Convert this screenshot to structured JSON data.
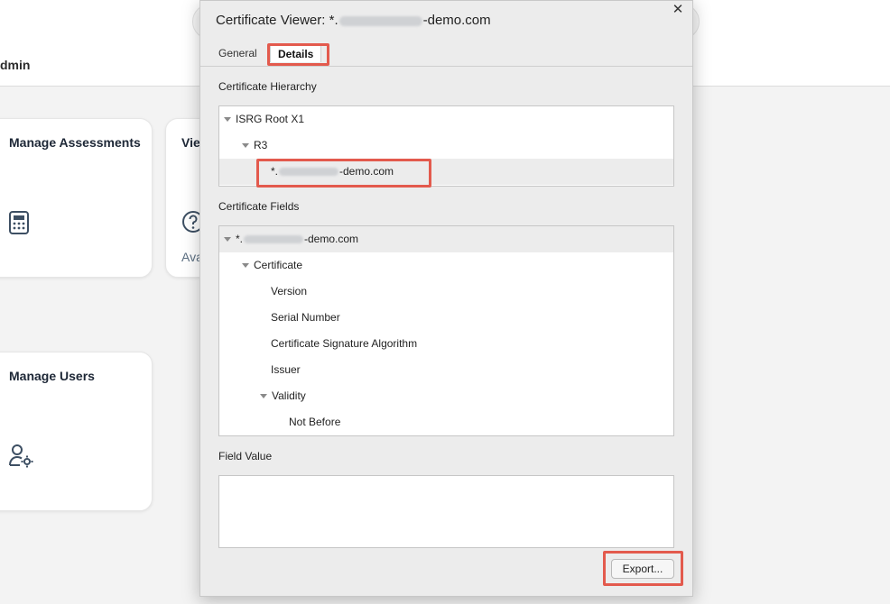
{
  "background": {
    "topbar": {
      "user_label": "dmin"
    },
    "cards": [
      {
        "title": "Manage Assessments",
        "icon": "calculator-icon"
      },
      {
        "title": "Vie",
        "icon": "help-circle-icon",
        "sub": "Ava"
      },
      {
        "title": "Manage Users",
        "icon": "user-settings-icon"
      }
    ]
  },
  "dialog": {
    "title_prefix": "Certificate Viewer: *.",
    "title_suffix": "-demo.com",
    "close_icon": "✕",
    "tabs": [
      {
        "label": "General",
        "active": false
      },
      {
        "label": "Details",
        "active": true
      }
    ],
    "hierarchy_label": "Certificate Hierarchy",
    "hierarchy": [
      {
        "label": "ISRG Root X1",
        "expanded": true
      },
      {
        "label": "R3",
        "expanded": true
      },
      {
        "prefix": "*.",
        "suffix": "-demo.com",
        "selected": true
      }
    ],
    "fields_label": "Certificate Fields",
    "fields": [
      {
        "prefix": "*.",
        "suffix": "-demo.com",
        "expanded": true,
        "selected": true
      },
      {
        "label": "Certificate",
        "expanded": true
      },
      {
        "label": "Version"
      },
      {
        "label": "Serial Number"
      },
      {
        "label": "Certificate Signature Algorithm"
      },
      {
        "label": "Issuer"
      },
      {
        "label": "Validity",
        "expanded": true
      },
      {
        "label": "Not Before"
      }
    ],
    "field_value_label": "Field Value",
    "field_value": "",
    "export_label": "Export..."
  },
  "colors": {
    "highlight": "#e35a4d",
    "selection": "#ececec"
  }
}
